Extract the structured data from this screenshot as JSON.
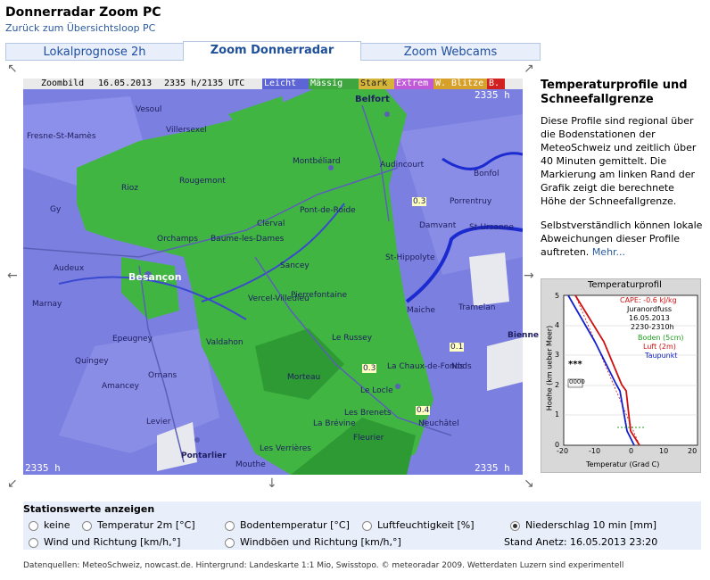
{
  "page": {
    "title": "Donnerradar Zoom PC",
    "back_link": "Zurück zum Übersichtsloop PC"
  },
  "tabs": [
    {
      "label": "Lokalprognose 2h",
      "active": false
    },
    {
      "label": "Zoom Donnerradar",
      "active": true
    },
    {
      "label": "Zoom Webcams",
      "active": false
    }
  ],
  "radar": {
    "label": "Zoombild",
    "date": "16.05.2013",
    "time": "2335 h/2135 UTC",
    "legend": [
      {
        "label": "Leicht",
        "color": "#5c64d6"
      },
      {
        "label": "Mässig",
        "color": "#3fa63f"
      },
      {
        "label": "Stark",
        "color": "#d4b53a"
      },
      {
        "label": "Extrem",
        "color": "#c05ad8"
      },
      {
        "label": "W. Blitze",
        "color": "#d7a02a"
      },
      {
        "label": "B.",
        "color": "#d02020"
      }
    ],
    "corner_time_top": "2335 h",
    "corner_time_bottom_left": "2335 h",
    "corner_time_bottom_right": "2335 h",
    "place_labels": [
      "Belfort",
      "Vesoul",
      "Montbéliard",
      "Audincourt",
      "Villersexel",
      "Rougemont",
      "Fresne-St-Mamès",
      "Gy",
      "Rioz",
      "Pont-de-Roide",
      "Baume-les-Dames",
      "Besançon",
      "Sancey",
      "Clerval",
      "St-Hippolyte",
      "Maiche",
      "Orchamps",
      "Ornans",
      "Valdahon",
      "Morteau",
      "Le Locle",
      "La Chaux-de-Fonds",
      "Neuchâtel",
      "Pontarlier",
      "Levier",
      "Amancey",
      "Quingey",
      "Audeux",
      "Marnay",
      "Epeugney",
      "Vercel-Villedieu",
      "Pierrefontaine",
      "Le Russey",
      "Les Brenets",
      "Bonfol",
      "Porrentruy",
      "St-Ursanne",
      "Tramelan",
      "Bienne",
      "La Brévine",
      "Fleurier",
      "Les Verrières",
      "Mouthe",
      "Nods",
      "Damvant"
    ],
    "values": [
      {
        "label": "0.3"
      },
      {
        "label": "0.3"
      },
      {
        "label": "0.4"
      },
      {
        "label": "0.1"
      }
    ]
  },
  "side": {
    "title": "Temperaturprofile und Schneefallgrenze",
    "para1": "Diese Profile sind regional über die Bodenstationen der MeteoSchweiz und zeitlich über 40 Minuten gemittelt. Die Markierung am linken Rand der Grafik zeigt die berechnete Höhe der Schneefallgrenze.",
    "para2": "Selbstverständlich können lokale Abweichungen dieser Profile auftreten.",
    "more_link": "Mehr..."
  },
  "profile": {
    "title": "Temperaturprofil",
    "cape": "CAPE: -0.6 kJ/kg",
    "region": "Juranordfuss",
    "date": "16.05.2013",
    "time": "2230-2310h",
    "legend_boden": "Boden (5cm)",
    "legend_luft": "Luft (2m)",
    "legend_taupunkt": "Taupunkt",
    "ylabel": "Hoehe (km ueber Meer)",
    "xlabel": "Temperatur (Grad C)",
    "yticks": [
      "5",
      "4",
      "3",
      "2",
      "1",
      "0"
    ],
    "xticks": [
      "-20",
      "-10",
      "0",
      "10",
      "20"
    ],
    "snow_marker": "***",
    "rain_marker": "0000",
    "colors": {
      "air": "#d01010",
      "dew": "#1020d0",
      "ground": "#20a020"
    }
  },
  "stations": {
    "title": "Stationswerte anzeigen",
    "options": [
      {
        "label": "keine",
        "checked": false
      },
      {
        "label": "Temperatur 2m [°C]",
        "checked": false
      },
      {
        "label": "Bodentemperatur [°C]",
        "checked": false
      },
      {
        "label": "Luftfeuchtigkeit [%]",
        "checked": false
      },
      {
        "label": "Niederschlag 10 min [mm]",
        "checked": true
      },
      {
        "label": "Wind und Richtung [km/h,°]",
        "checked": false
      },
      {
        "label": "Windböen und Richtung [km/h,°]",
        "checked": false
      }
    ],
    "stand": "Stand Anetz: 16.05.2013 23:20"
  },
  "footer": "Datenquellen: MeteoSchweiz, nowcast.de. Hintergrund: Landeskarte 1:1 Mio, Swisstopo. © meteoradar 2009. Wetterdaten Luzern sind experimentell"
}
